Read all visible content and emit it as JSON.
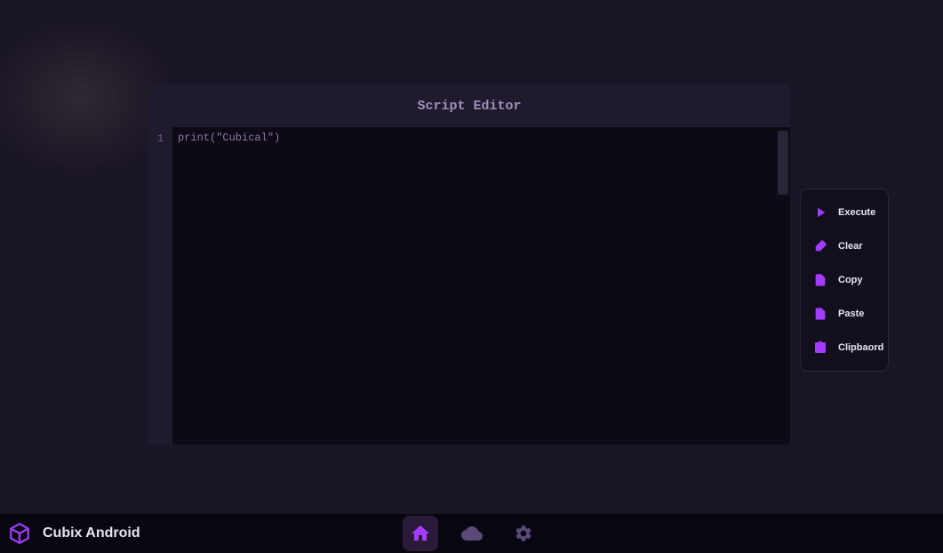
{
  "editor": {
    "title": "Script Editor",
    "line_numbers": [
      "1"
    ],
    "code": "print(\"Cubical\")"
  },
  "actions": {
    "execute": "Execute",
    "clear": "Clear",
    "copy": "Copy",
    "paste": "Paste",
    "clipboard": "Clipbaord"
  },
  "brand": {
    "name": "Cubix Android"
  },
  "colors": {
    "accent": "#a23cff"
  }
}
